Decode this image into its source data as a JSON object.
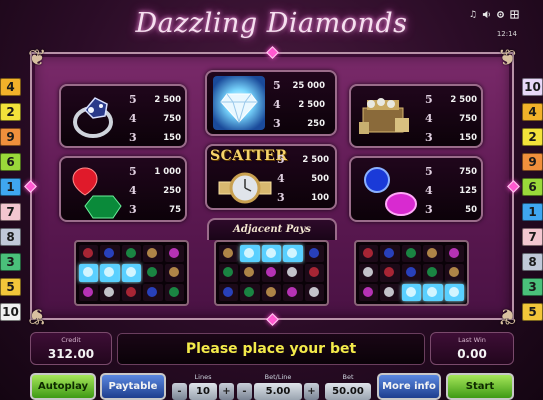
{
  "title": "Dazzling Diamonds",
  "status_bar": {
    "icons": [
      "music-icon",
      "sound-icon",
      "settings-icon",
      "fullscreen-icon"
    ],
    "icon_glyphs": [
      "♫",
      "🔊",
      "⚙",
      "⛶"
    ],
    "time": "12:14"
  },
  "left_lines": [
    {
      "n": "4",
      "color": "#f2b12a"
    },
    {
      "n": "2",
      "color": "#f3e23a"
    },
    {
      "n": "9",
      "color": "#f08f3c"
    },
    {
      "n": "6",
      "color": "#9ad83a"
    },
    {
      "n": "1",
      "color": "#3fa6f0"
    },
    {
      "n": "7",
      "color": "#f3c6d0"
    },
    {
      "n": "8",
      "color": "#c0c8d8"
    },
    {
      "n": "3",
      "color": "#4ac07a"
    },
    {
      "n": "5",
      "color": "#f2c63a"
    },
    {
      "n": "10",
      "color": "#f0f0f0"
    }
  ],
  "right_lines": [
    {
      "n": "10",
      "color": "#e8d8f8"
    },
    {
      "n": "4",
      "color": "#f2b12a"
    },
    {
      "n": "2",
      "color": "#f3e23a"
    },
    {
      "n": "9",
      "color": "#f08f3c"
    },
    {
      "n": "6",
      "color": "#9ad83a"
    },
    {
      "n": "1",
      "color": "#3fa6f0"
    },
    {
      "n": "7",
      "color": "#f3c6d0"
    },
    {
      "n": "8",
      "color": "#c0c8d8"
    },
    {
      "n": "3",
      "color": "#4ac07a"
    },
    {
      "n": "5",
      "color": "#f2c63a"
    }
  ],
  "paytable": {
    "ring": [
      {
        "k": "5",
        "v": "2 500"
      },
      {
        "k": "4",
        "v": "750"
      },
      {
        "k": "3",
        "v": "150"
      }
    ],
    "diamond": [
      {
        "k": "5",
        "v": "25 000"
      },
      {
        "k": "4",
        "v": "2 500"
      },
      {
        "k": "3",
        "v": "250"
      }
    ],
    "chest": [
      {
        "k": "5",
        "v": "2 500"
      },
      {
        "k": "4",
        "v": "750"
      },
      {
        "k": "3",
        "v": "150"
      }
    ],
    "red_green": [
      {
        "k": "5",
        "v": "1 000"
      },
      {
        "k": "4",
        "v": "250"
      },
      {
        "k": "3",
        "v": "75"
      }
    ],
    "scatter": [
      {
        "k": "5",
        "v": "2 500"
      },
      {
        "k": "4",
        "v": "500"
      },
      {
        "k": "3",
        "v": "100"
      }
    ],
    "blue_purple": [
      {
        "k": "5",
        "v": "750"
      },
      {
        "k": "4",
        "v": "125"
      },
      {
        "k": "3",
        "v": "50"
      }
    ]
  },
  "scatter_label": "SCATTER",
  "adjacent_pays": "Adjacent Pays",
  "credit": {
    "label": "Credit",
    "value": "312.00"
  },
  "message": "Please place your bet",
  "last_win": {
    "label": "Last Win",
    "value": "0.00"
  },
  "buttons": {
    "autoplay": "Autoplay",
    "paytable": "Paytable",
    "more_info": "More info",
    "start": "Start"
  },
  "lines": {
    "label": "Lines",
    "value": "10"
  },
  "bet_line": {
    "label": "Bet/Line",
    "value": "5.00"
  },
  "bet": {
    "label": "Bet",
    "value": "50.00"
  },
  "controls": {
    "minus": "-",
    "plus": "+"
  }
}
